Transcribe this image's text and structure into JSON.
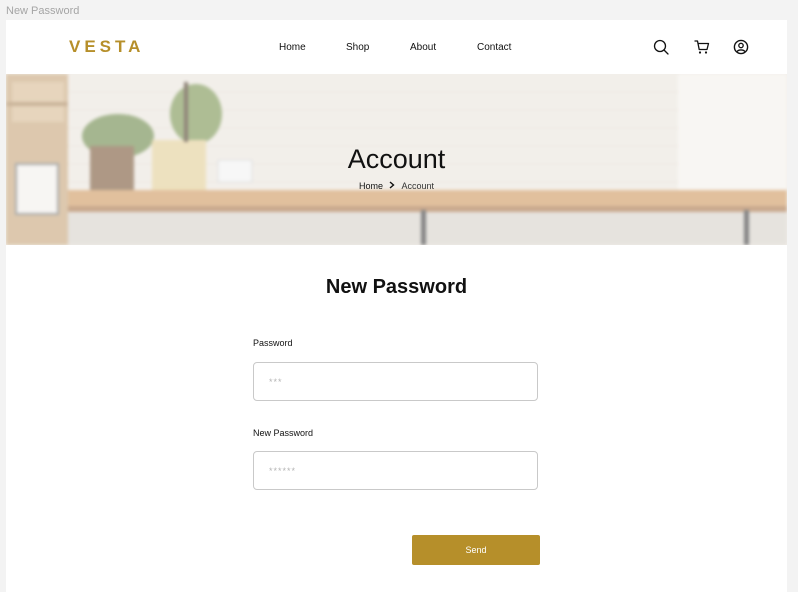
{
  "frame_label": "New Password",
  "brand": {
    "logo_text": "VESTA",
    "accent_color": "#b68f2a"
  },
  "nav": {
    "items": [
      {
        "label": "Home"
      },
      {
        "label": "Shop"
      },
      {
        "label": "About"
      },
      {
        "label": "Contact"
      }
    ]
  },
  "header_icons": [
    "search-icon",
    "cart-icon",
    "user-account-icon"
  ],
  "hero": {
    "title": "Account",
    "breadcrumb": {
      "home": "Home",
      "separator_icon": "chevron-right-icon",
      "current": "Account"
    }
  },
  "form": {
    "title": "New Password",
    "password": {
      "label": "Password",
      "placeholder": "***"
    },
    "new_password": {
      "label": "New Password",
      "placeholder": "******"
    },
    "submit_label": "Send"
  }
}
